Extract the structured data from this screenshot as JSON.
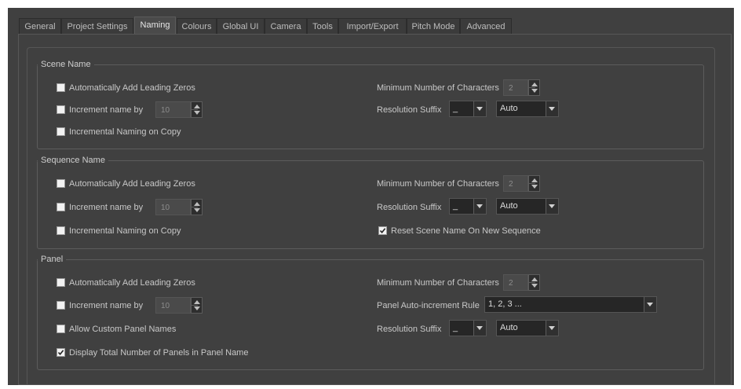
{
  "tabs": [
    "General",
    "Project Settings",
    "Naming",
    "Colours",
    "Global UI",
    "Camera",
    "Tools",
    "Import/Export",
    "Pitch Mode",
    "Advanced"
  ],
  "active_tab": "Naming",
  "scene": {
    "title": "Scene Name",
    "leading_zeros": {
      "label": "Automatically Add Leading Zeros",
      "checked": false
    },
    "increment": {
      "label": "Increment name by",
      "checked": false,
      "value": "10"
    },
    "incremental_copy": {
      "label": "Incremental Naming on Copy",
      "checked": false
    },
    "min_chars": {
      "label": "Minimum Number of Characters",
      "value": "2"
    },
    "res_suffix": {
      "label": "Resolution Suffix",
      "separator": "_",
      "mode": "Auto"
    }
  },
  "sequence": {
    "title": "Sequence Name",
    "leading_zeros": {
      "label": "Automatically Add Leading Zeros",
      "checked": false
    },
    "increment": {
      "label": "Increment name by",
      "checked": false,
      "value": "10"
    },
    "incremental_copy": {
      "label": "Incremental Naming on Copy",
      "checked": false
    },
    "min_chars": {
      "label": "Minimum Number of Characters",
      "value": "2"
    },
    "res_suffix": {
      "label": "Resolution Suffix",
      "separator": "_",
      "mode": "Auto"
    },
    "reset_scene": {
      "label": "Reset Scene Name On New Sequence",
      "checked": true
    }
  },
  "panel": {
    "title": "Panel",
    "leading_zeros": {
      "label": "Automatically Add Leading Zeros",
      "checked": false
    },
    "increment": {
      "label": "Increment name by",
      "checked": false,
      "value": "10"
    },
    "custom_names": {
      "label": "Allow Custom Panel Names",
      "checked": false
    },
    "display_total": {
      "label": "Display Total Number of Panels in Panel Name",
      "checked": true
    },
    "min_chars": {
      "label": "Minimum Number of Characters",
      "value": "2"
    },
    "auto_rule": {
      "label": "Panel Auto-increment Rule",
      "value": "1, 2, 3 ..."
    },
    "res_suffix": {
      "label": "Resolution Suffix",
      "separator": "_",
      "mode": "Auto"
    }
  }
}
